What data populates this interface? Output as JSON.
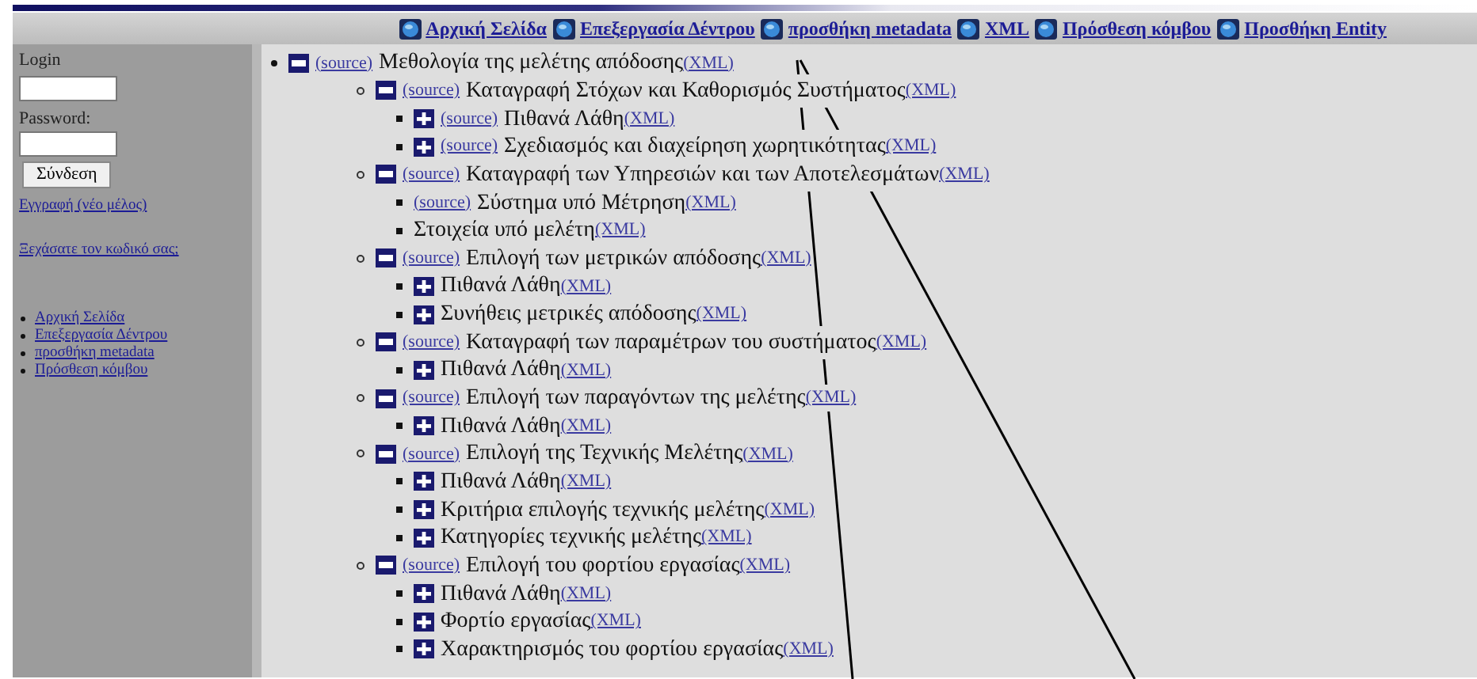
{
  "nav": [
    {
      "label": "Αρχική Σελίδα"
    },
    {
      "label": "Επεξεργασία Δέντρου"
    },
    {
      "label": "προσθήκη metadata"
    },
    {
      "label": "XML"
    },
    {
      "label": "Πρόσθεση κόμβου"
    },
    {
      "label": "Προσθήκη Entity"
    }
  ],
  "sidebar": {
    "login_label": "Login",
    "password_label": "Password:",
    "login_button": "Σύνδεση",
    "register_link": "Εγγραφή (νέο μέλος)",
    "forgot_link": "Ξεχάσατε τον κωδικό σας;",
    "links": [
      "Αρχική Σελίδα",
      "Επεξεργασία Δέντρου",
      "προσθήκη metadata",
      "Πρόσθεση κόμβου"
    ]
  },
  "tree": [
    {
      "expanded": true,
      "source": "(source)",
      "label": "Μεθολογία της μελέτης απόδοσης",
      "xml": "(XML)",
      "children": [
        {
          "expanded": true,
          "source": "(source)",
          "label": "Καταγραφή Στόχων και Καθορισμός Συστήματος",
          "xml": "(XML)",
          "children": [
            {
              "expanded": false,
              "source": "(source)",
              "label": "Πιθανά Λάθη",
              "xml": "(XML)"
            },
            {
              "expanded": false,
              "source": "(source)",
              "label": "Σχεδιασμός και διαχείρηση χωρητικότητας",
              "xml": "(XML)"
            }
          ]
        },
        {
          "expanded": true,
          "source": "(source)",
          "label": "Καταγραφή των Υπηρεσιών και των Αποτελεσμάτων",
          "xml": "(XML)",
          "children": [
            {
              "source": "(source)",
              "label": "Σύστημα υπό Μέτρηση",
              "xml": "(XML)"
            },
            {
              "label": "Στοιχεία υπό μελέτη",
              "xml": "(XML)"
            }
          ]
        },
        {
          "expanded": true,
          "source": "(source)",
          "label": "Επιλογή των μετρικών απόδοσης",
          "xml": "(XML)",
          "children": [
            {
              "expanded": false,
              "label": "Πιθανά Λάθη",
              "xml": "(XML)"
            },
            {
              "expanded": false,
              "label": "Συνήθεις μετρικές απόδοσης",
              "xml": "(XML)"
            }
          ]
        },
        {
          "expanded": true,
          "source": "(source)",
          "label": "Καταγραφή των παραμέτρων του συστήματος",
          "xml": "(XML)",
          "children": [
            {
              "expanded": false,
              "label": "Πιθανά Λάθη",
              "xml": "(XML)"
            }
          ]
        },
        {
          "expanded": true,
          "source": "(source)",
          "label": "Επιλογή των παραγόντων της μελέτης",
          "xml": "(XML)",
          "children": [
            {
              "expanded": false,
              "label": "Πιθανά Λάθη",
              "xml": "(XML)"
            }
          ]
        },
        {
          "expanded": true,
          "source": "(source)",
          "label": "Επιλογή της Τεχνικής Μελέτης",
          "xml": "(XML)",
          "children": [
            {
              "expanded": false,
              "label": "Πιθανά Λάθη",
              "xml": "(XML)"
            },
            {
              "expanded": false,
              "label": "Κριτήρια επιλογής τεχνικής μελέτης",
              "xml": "(XML)"
            },
            {
              "expanded": false,
              "label": "Κατηγορίες τεχνικής μελέτης",
              "xml": "(XML)"
            }
          ]
        },
        {
          "expanded": true,
          "source": "(source)",
          "label": "Επιλογή του φορτίου εργασίας",
          "xml": "(XML)",
          "children": [
            {
              "expanded": false,
              "label": "Πιθανά Λάθη",
              "xml": "(XML)"
            },
            {
              "expanded": false,
              "label": "Φορτίο εργασίας",
              "xml": "(XML)"
            },
            {
              "expanded": false,
              "label": "Χαρακτηρισμός του φορτίου εργασίας",
              "xml": "(XML)"
            }
          ]
        }
      ]
    }
  ]
}
